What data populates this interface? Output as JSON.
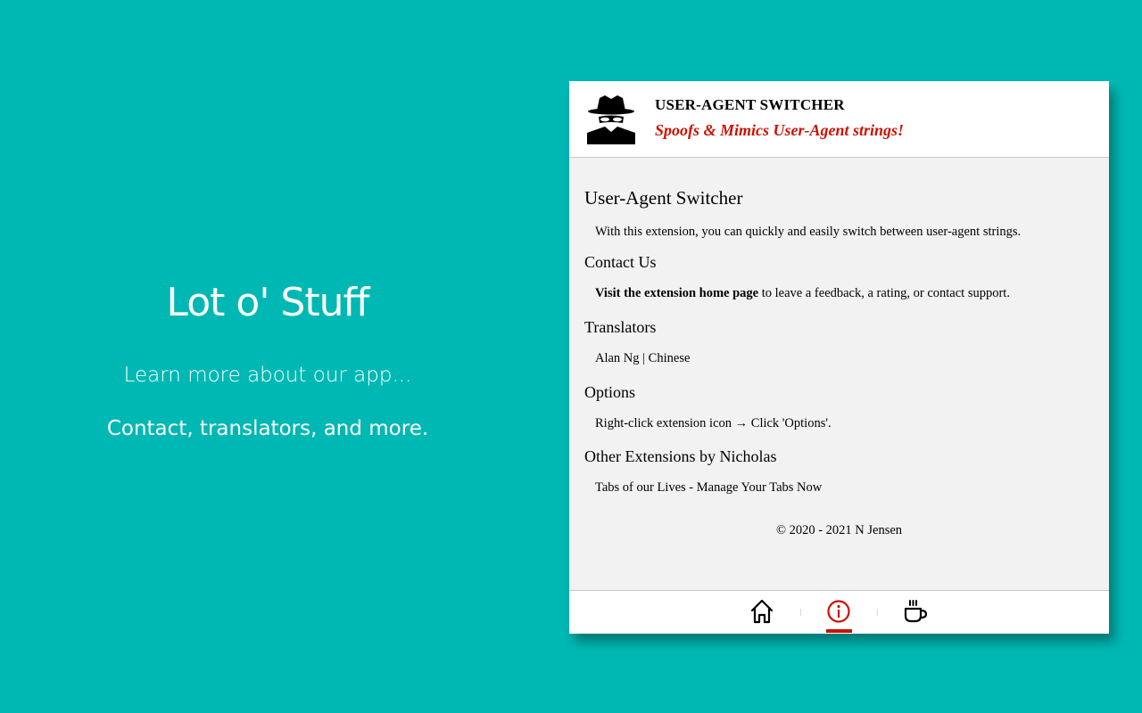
{
  "promo": {
    "title": "Lot o' Stuff",
    "line1": "Learn more about our app...",
    "line2": "Contact, translators, and more."
  },
  "popup": {
    "header": {
      "title": "USER-AGENT SWITCHER",
      "subtitle": "Spoofs & Mimics User-Agent strings!",
      "logo_icon": "spy-icon"
    },
    "sections": {
      "about": {
        "heading": "User-Agent Switcher",
        "text": "With this extension, you can quickly and easily switch between user-agent strings."
      },
      "contact": {
        "heading": "Contact Us",
        "link_text": "Visit the extension home page",
        "text": " to leave a feedback, a rating, or contact support."
      },
      "translators": {
        "heading": "Translators",
        "text": "Alan Ng | Chinese"
      },
      "options": {
        "heading": "Options",
        "text": "Right-click extension icon → Click 'Options'."
      },
      "other": {
        "heading": "Other Extensions by Nicholas",
        "text": "Tabs of our Lives - Manage Your Tabs Now"
      }
    },
    "copyright": "© 2020 - 2021   N Jensen",
    "footer": {
      "icons": [
        "home-icon",
        "info-icon",
        "coffee-icon"
      ],
      "active": "info-icon"
    }
  },
  "colors": {
    "background": "#00b8b3",
    "accent": "#cc1100",
    "panel": "#f2f2f2"
  }
}
